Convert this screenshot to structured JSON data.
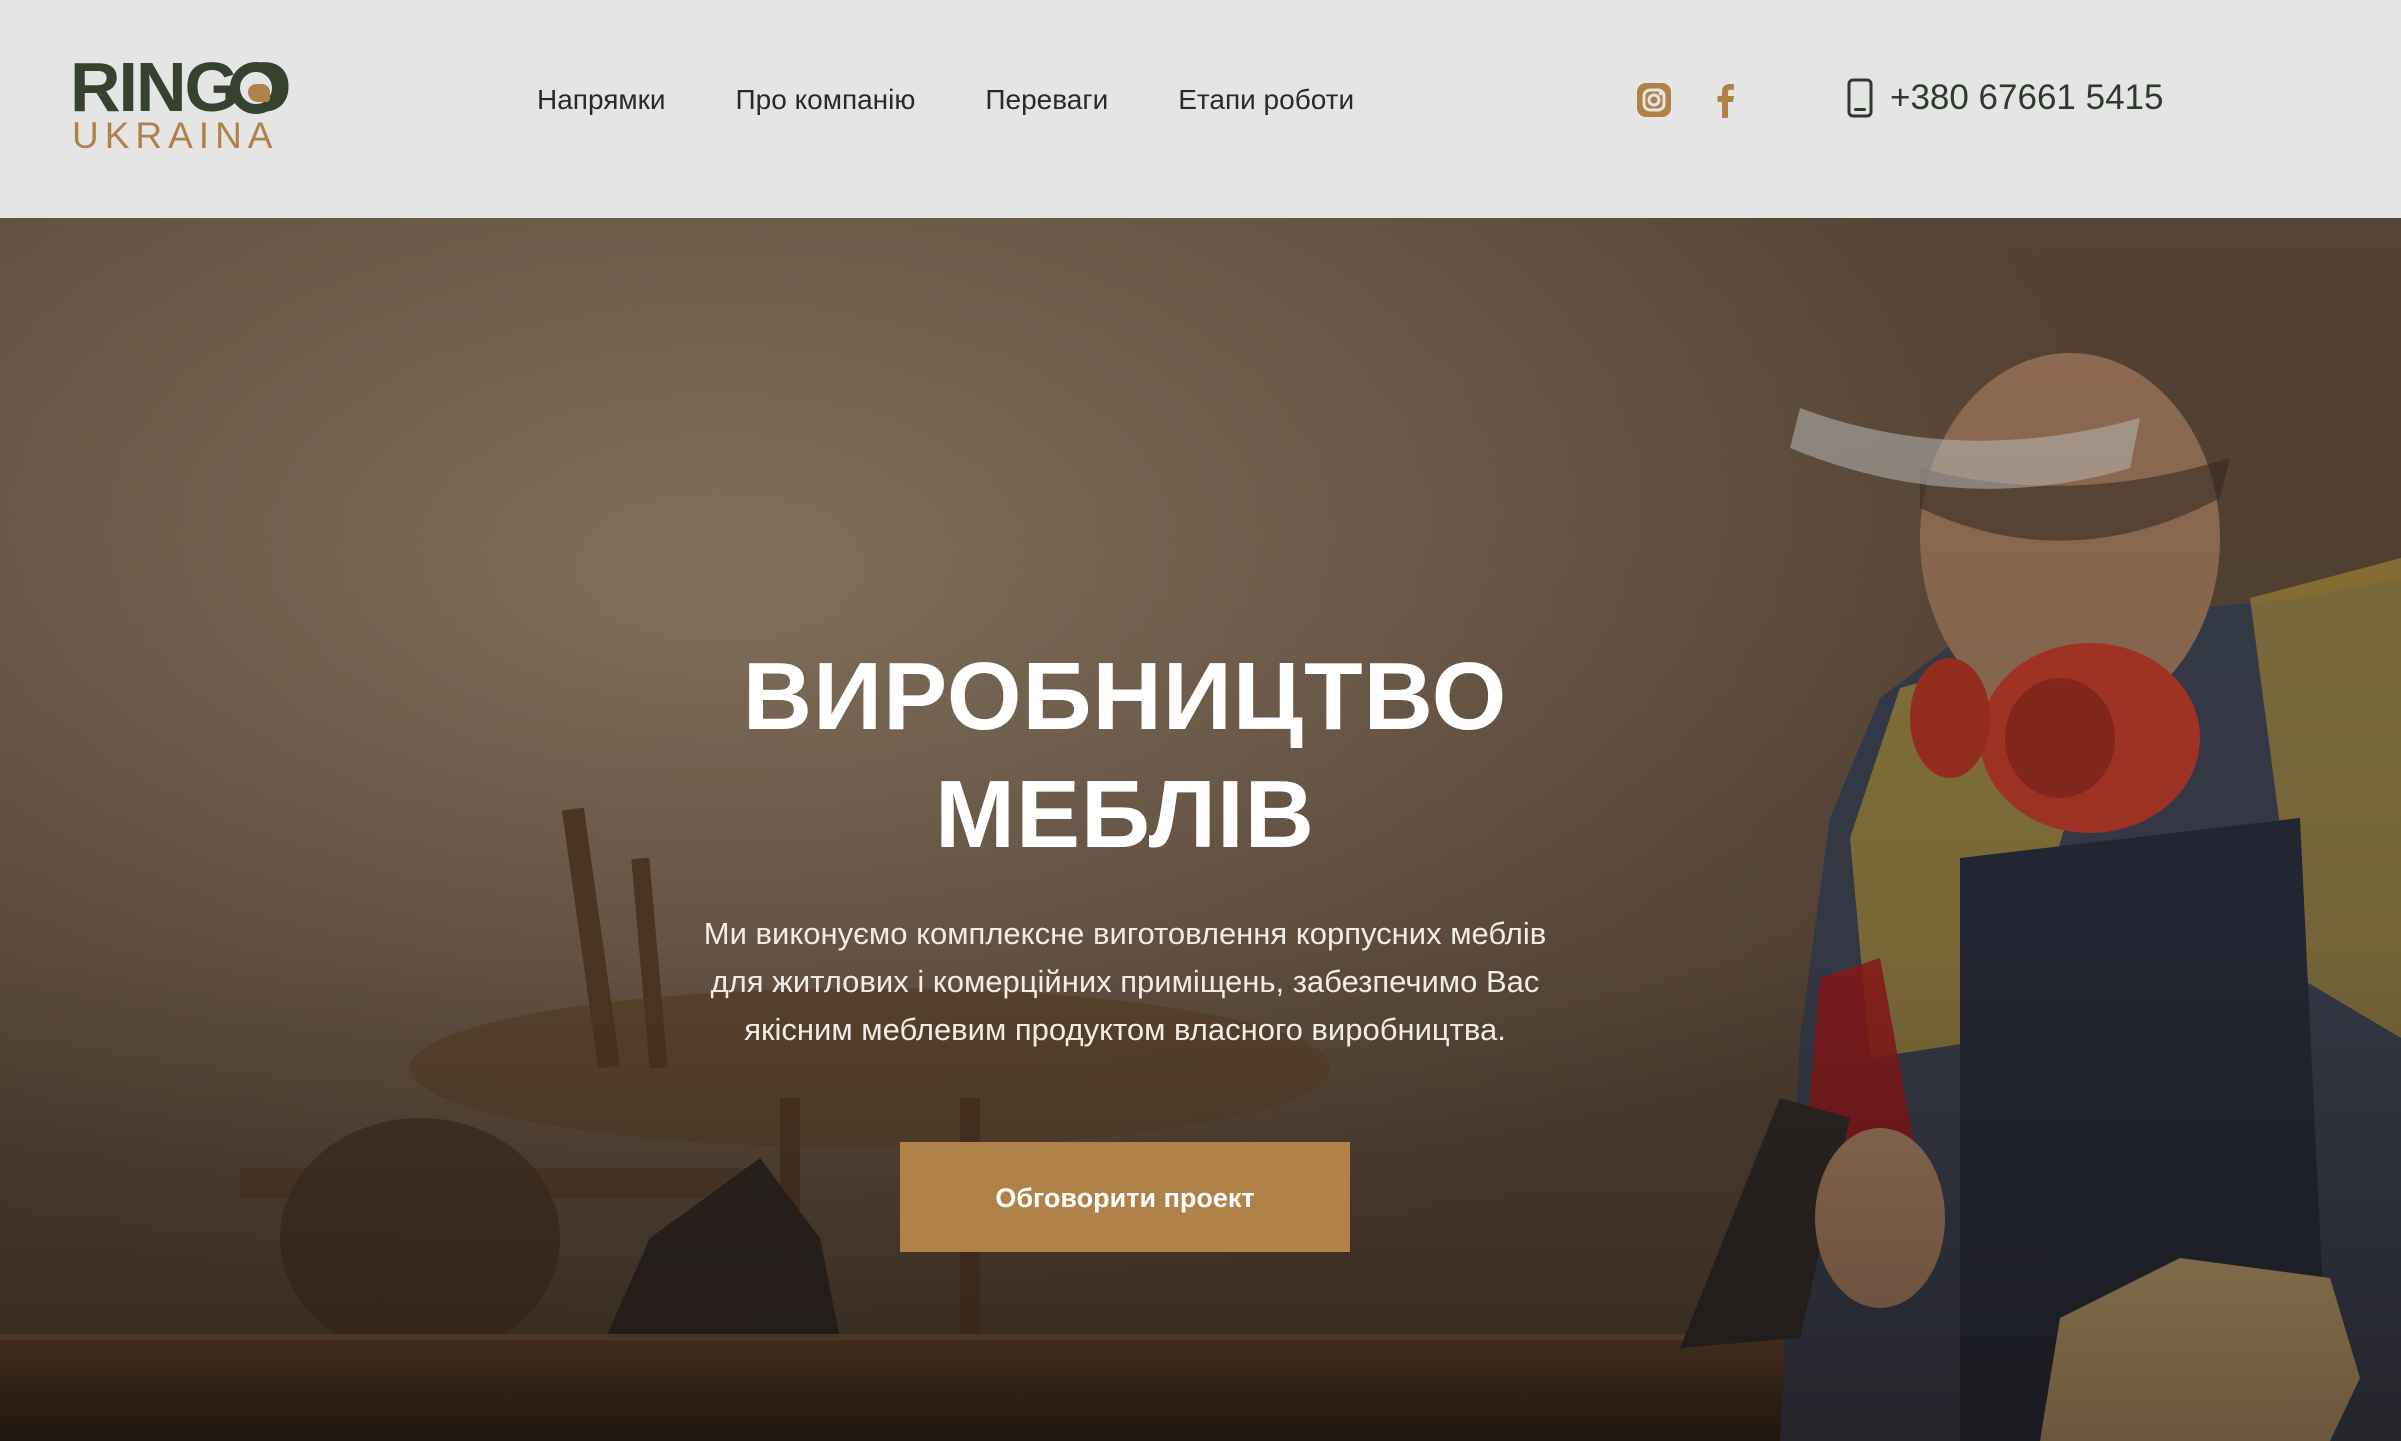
{
  "header": {
    "logo": {
      "title": "RINGO",
      "subtitle": "UKRAINA"
    },
    "nav": [
      {
        "label": "Напрямки"
      },
      {
        "label": "Про компанію"
      },
      {
        "label": "Переваги"
      },
      {
        "label": "Етапи роботи"
      }
    ],
    "social": [
      {
        "icon": "instagram-icon"
      },
      {
        "icon": "facebook-icon"
      }
    ],
    "phone": {
      "icon": "mobile-phone-icon",
      "number": "+380 67661 5415"
    }
  },
  "hero": {
    "title_line1": "ВИРОБНИЦТВО",
    "title_line2": "МЕБЛІВ",
    "description": "Ми виконуємо комплексне виготовлення корпусних меблів для житлових і комерційних приміщень, забезпечимо Вас якісним меблевим продуктом власного виробництва.",
    "cta_label": "Обговорити проект"
  },
  "colors": {
    "header_bg": "#e5e5e5",
    "brand_green": "#36412f",
    "accent_gold": "#b0824a",
    "text_dark": "#2a2a2a"
  }
}
